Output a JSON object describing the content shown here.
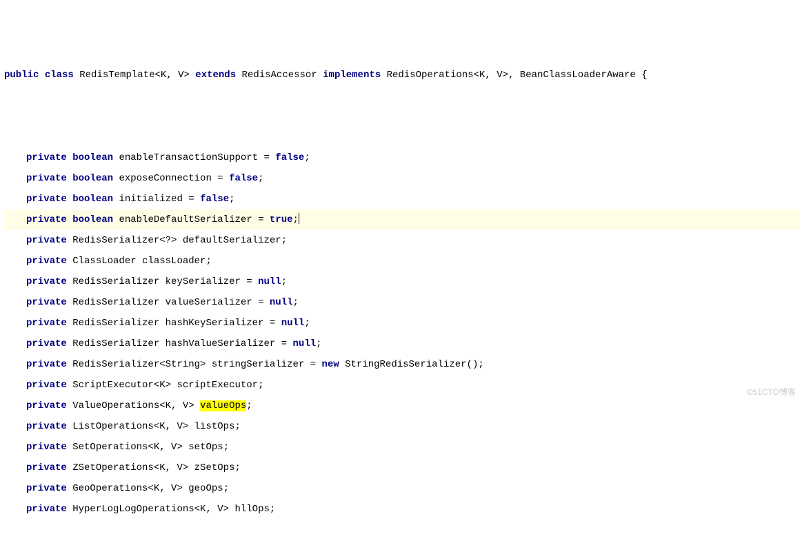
{
  "watermark": "©51CTO博客",
  "tokens": {
    "public": "public",
    "class": "class",
    "extends": "extends",
    "implements": "implements",
    "private": "private",
    "boolean": "boolean",
    "false": "false",
    "true": "true",
    "null": "null",
    "new": "new"
  },
  "declaration": {
    "className": "RedisTemplate",
    "generics": "<K, V>",
    "extendsClass": "RedisAccessor",
    "implementsList": "RedisOperations<K, V>, BeanClassLoaderAware",
    "openBrace": "{"
  },
  "fields": [
    {
      "type_kw": "boolean",
      "name": "enableTransactionSupport",
      "assign": " = ",
      "value_kw": "false",
      "tail": ";"
    },
    {
      "type_kw": "boolean",
      "name": "exposeConnection",
      "assign": " = ",
      "value_kw": "false",
      "tail": ";"
    },
    {
      "type_kw": "boolean",
      "name": "initialized",
      "assign": " = ",
      "value_kw": "false",
      "tail": ";"
    },
    {
      "type_kw": "boolean",
      "name": "enableDefaultSerializer",
      "assign": " = ",
      "value_kw": "true",
      "tail": ";",
      "highlightLine": true,
      "caretAfter": true
    },
    {
      "type": "RedisSerializer<?>",
      "name": "defaultSerializer",
      "tail": ";"
    },
    {
      "type": "ClassLoader",
      "name": "classLoader",
      "tail": ";"
    },
    {
      "type": "RedisSerializer",
      "name": "keySerializer",
      "assign": " = ",
      "value_kw": "null",
      "tail": ";"
    },
    {
      "type": "RedisSerializer",
      "name": "valueSerializer",
      "assign": " = ",
      "value_kw": "null",
      "tail": ";"
    },
    {
      "type": "RedisSerializer",
      "name": "hashKeySerializer",
      "assign": " = ",
      "value_kw": "null",
      "tail": ";"
    },
    {
      "type": "RedisSerializer",
      "name": "hashValueSerializer",
      "assign": " = ",
      "value_kw": "null",
      "tail": ";"
    },
    {
      "type": "RedisSerializer<String>",
      "name": "stringSerializer",
      "assign": " = ",
      "new_kw": "new",
      "ctor": " StringRedisSerializer()",
      "tail": ";"
    },
    {
      "type": "ScriptExecutor<K>",
      "name": "scriptExecutor",
      "tail": ";"
    },
    {
      "type": "ValueOperations<K, V>",
      "name": "valueOps",
      "tail": ";",
      "highlightName": true
    },
    {
      "type": "ListOperations<K, V>",
      "name": "listOps",
      "tail": ";"
    },
    {
      "type": "SetOperations<K, V>",
      "name": "setOps",
      "tail": ";"
    },
    {
      "type": "ZSetOperations<K, V>",
      "name": "zSetOps",
      "tail": ";"
    },
    {
      "type": "GeoOperations<K, V>",
      "name": "geoOps",
      "tail": ";"
    },
    {
      "type": "HyperLogLogOperations<K, V>",
      "name": "hllOps",
      "tail": ";"
    }
  ]
}
